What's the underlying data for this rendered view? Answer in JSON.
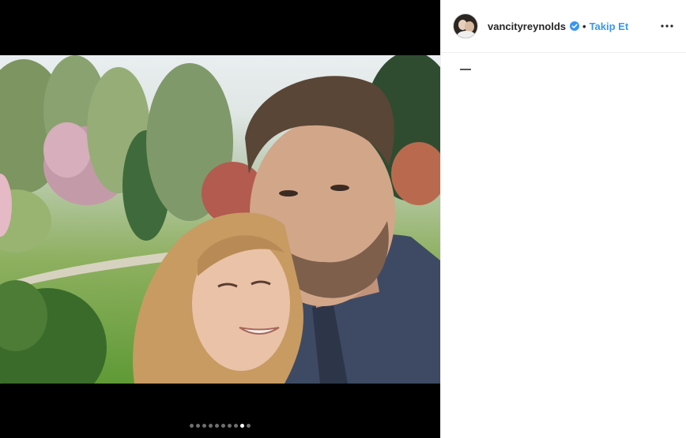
{
  "post": {
    "username": "vancityreynolds",
    "separator": "•",
    "follow_label": "Takip Et",
    "verified_icon": "verified-badge-icon",
    "more_icon": "more-options-icon"
  },
  "carousel": {
    "total": 10,
    "active_index": 8
  },
  "colors": {
    "follow_blue": "#3897f0",
    "verified_blue": "#3897f0",
    "media_background": "#000000"
  }
}
